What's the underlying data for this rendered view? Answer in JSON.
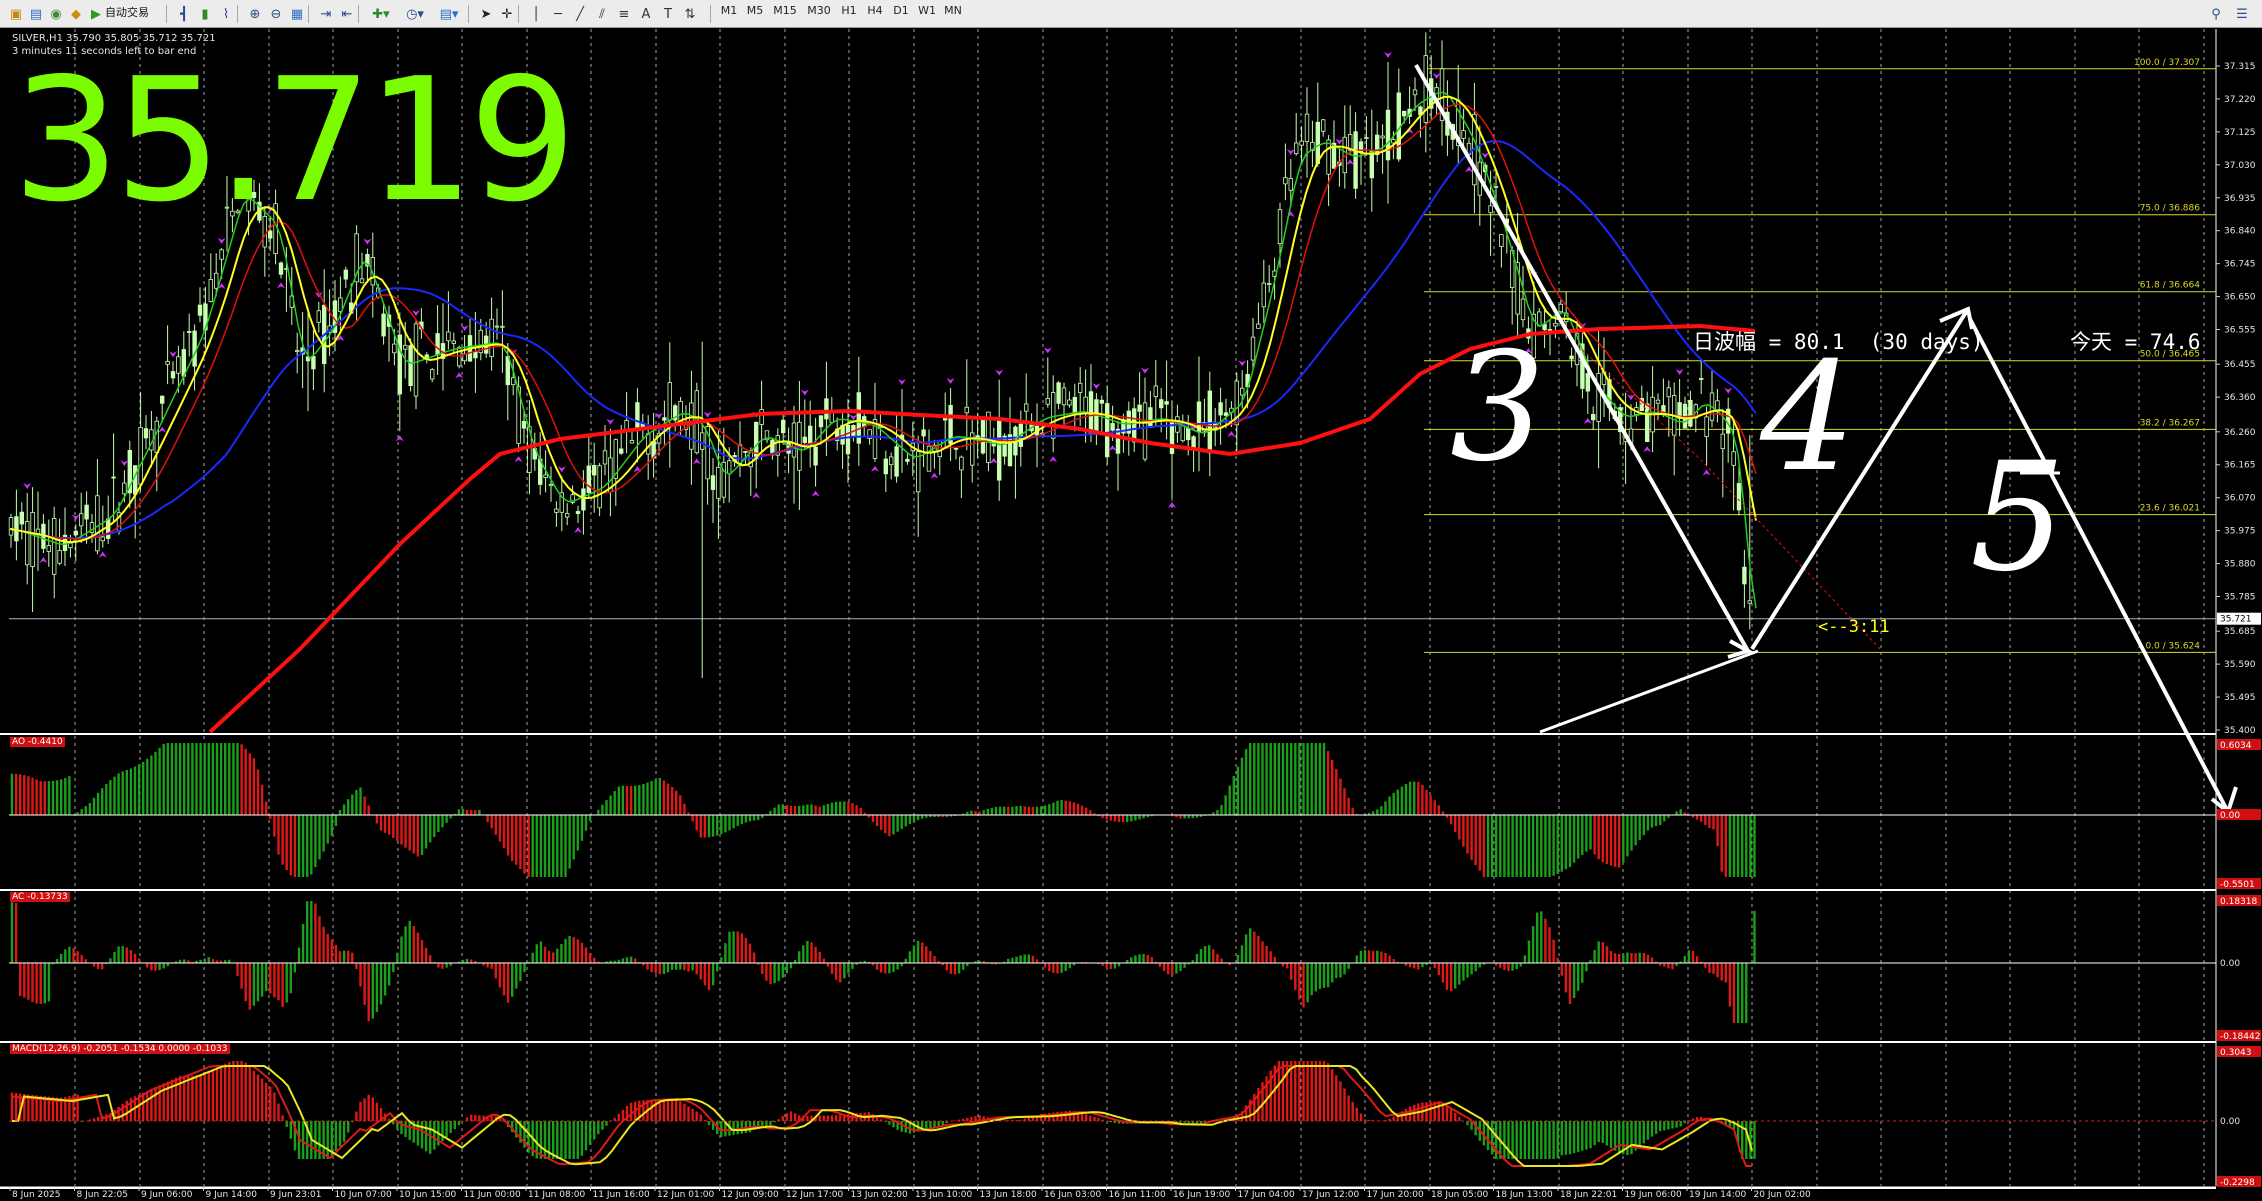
{
  "toolbar": {
    "auto_trading_label": "自动交易",
    "timeframes": [
      "M1",
      "M5",
      "M15",
      "M30",
      "H1",
      "H4",
      "D1",
      "W1",
      "MN"
    ]
  },
  "chart_window": {
    "symbol_header": "SILVER,H1  35.790 35.805 35.712 35.721",
    "countdown": "3 minutes 11 seconds left to bar end",
    "big_price": "35.719",
    "daily_range_text": "日波幅 = 80.1  (30 days)",
    "today_text": "今天 = 74.6",
    "bar_timer": "<--3:11",
    "current_price_tag": "35.721",
    "wave_labels": [
      "3",
      "4",
      "5"
    ]
  },
  "price_axis": {
    "ticks": [
      "37.315",
      "37.220",
      "37.125",
      "37.030",
      "36.935",
      "36.840",
      "36.745",
      "36.650",
      "36.555",
      "36.455",
      "36.360",
      "36.260",
      "36.165",
      "36.070",
      "35.975",
      "35.880",
      "35.785",
      "35.685",
      "35.590",
      "35.495",
      "35.400"
    ]
  },
  "fibonacci": {
    "levels": [
      {
        "label": "100.0 / 37.307",
        "price": 37.307
      },
      {
        "label": "75.0 / 36.886",
        "price": 36.886
      },
      {
        "label": "61.8 / 36.664",
        "price": 36.664
      },
      {
        "label": "50.0 / 36.465",
        "price": 36.465
      },
      {
        "label": "38.2 / 36.267",
        "price": 36.267
      },
      {
        "label": "23.6 / 36.021",
        "price": 36.021
      },
      {
        "label": "0.0 / 35.624",
        "price": 35.624
      }
    ]
  },
  "ao_panel": {
    "title": "AO -0.4410",
    "top_label": "0.6034",
    "zero_label": "0.00",
    "bottom_label": "-0.5501"
  },
  "ac_panel": {
    "title": "AC -0.13733",
    "top_label": "0.18318",
    "zero_label": "0.00",
    "bottom_label": "-0.18442"
  },
  "macd_panel": {
    "title": "MACD(12,26,9) -0.2051 -0.1534 0.0000 -0.1033",
    "top_label": "0.3043",
    "zero_label": "0.00",
    "bottom_label": "-0.2298"
  },
  "time_axis": {
    "labels": [
      "8 Jun 2025",
      "8 Jun 22:05",
      "9 Jun 06:00",
      "9 Jun 14:00",
      "9 Jun 23:01",
      "10 Jun 07:00",
      "10 Jun 15:00",
      "11 Jun 00:00",
      "11 Jun 08:00",
      "11 Jun 16:00",
      "12 Jun 01:00",
      "12 Jun 09:00",
      "12 Jun 17:00",
      "13 Jun 02:00",
      "13 Jun 10:00",
      "13 Jun 18:00",
      "16 Jun 03:00",
      "16 Jun 11:00",
      "16 Jun 19:00",
      "17 Jun 04:00",
      "17 Jun 12:00",
      "17 Jun 20:00",
      "18 Jun 05:00",
      "18 Jun 13:00",
      "18 Jun 22:01",
      "19 Jun 06:00",
      "19 Jun 14:00",
      "20 Jun 02:00"
    ]
  },
  "colors": {
    "candle": "#c8ffb0",
    "grid": "#cfcfcf",
    "fib": "#d9d92a",
    "ma_red": "#ff1010",
    "ma_yellow": "#ffff20",
    "ma_green": "#20d020",
    "ma_blue": "#1a28ff",
    "fractal": "#d030ff",
    "price_big": "#7cfc00",
    "hist_up": "#1aa01a",
    "hist_down": "#e01818",
    "macd_signal": "#e8e820",
    "annotation": "#ffffff"
  }
}
